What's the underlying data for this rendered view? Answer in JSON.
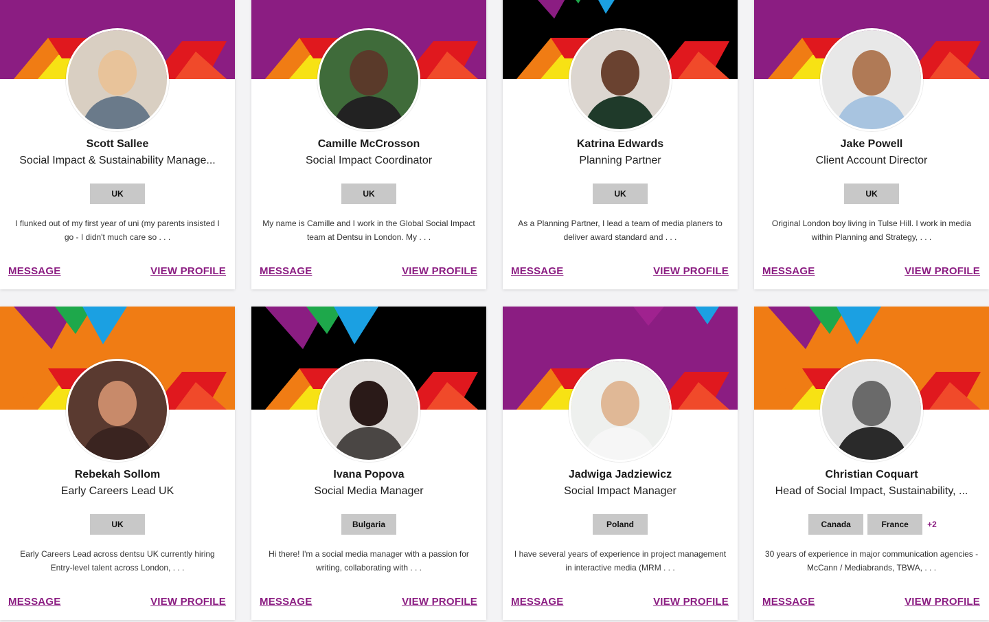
{
  "actions": {
    "message_label": "MESSAGE",
    "view_profile_label": "VIEW PROFILE"
  },
  "colors": {
    "purple": "#8b1d82",
    "orange": "#f07c14",
    "black": "#000000",
    "red": "#e0181e",
    "yellow": "#f7e214",
    "blue": "#1ba0e2",
    "green": "#1ea84b",
    "tag_bg": "#c8c8c8"
  },
  "cards": [
    {
      "name": "Scott Sallee",
      "title": "Social Impact & Sustainability Manage...",
      "tags": [
        "UK"
      ],
      "more": "",
      "bio": "I flunked out of my first year of uni (my parents insisted I go - I didn't much care so . . .",
      "banner": "purple",
      "avatar_icon": "person-photo"
    },
    {
      "name": "Camille McCrosson",
      "title": "Social Impact Coordinator",
      "tags": [
        "UK"
      ],
      "more": "",
      "bio": "My name is Camille and I work in the Global Social Impact team at Dentsu in London. My . . .",
      "banner": "purple",
      "avatar_icon": "person-photo"
    },
    {
      "name": "Katrina Edwards",
      "title": "Planning Partner",
      "tags": [
        "UK"
      ],
      "more": "",
      "bio": "As a Planning Partner, I lead a team of media planers to deliver award standard and . . .",
      "banner": "black",
      "avatar_icon": "person-photo"
    },
    {
      "name": "Jake Powell",
      "title": "Client Account Director",
      "tags": [
        "UK"
      ],
      "more": "",
      "bio": "Original London boy living in Tulse Hill. I work in media within Planning and Strategy, . . .",
      "banner": "purple",
      "avatar_icon": "person-photo"
    },
    {
      "name": "Rebekah Sollom",
      "title": "Early Careers Lead UK",
      "tags": [
        "UK"
      ],
      "more": "",
      "bio": "Early Careers Lead across dentsu UK currently hiring Entry-level talent across London, . . .",
      "banner": "orange",
      "avatar_icon": "person-photo"
    },
    {
      "name": "Ivana Popova",
      "title": "Social Media Manager",
      "tags": [
        "Bulgaria"
      ],
      "more": "",
      "bio": "Hi there! I'm a social media manager with a passion for writing, collaborating with . . .",
      "banner": "black",
      "avatar_icon": "person-photo"
    },
    {
      "name": "Jadwiga Jadziewicz",
      "title": "Social Impact Manager",
      "tags": [
        "Poland"
      ],
      "more": "",
      "bio": "I have several years of experience in project management in interactive media (MRM . . .",
      "banner": "purple",
      "avatar_icon": "person-photo"
    },
    {
      "name": "Christian Coquart",
      "title": "Head of Social Impact, Sustainability, ...",
      "tags": [
        "Canada",
        "France"
      ],
      "more": "+2",
      "bio": "30 years of experience in major communication agencies - McCann / Mediabrands, TBWA, . . .",
      "banner": "orange",
      "avatar_icon": "person-photo"
    }
  ]
}
